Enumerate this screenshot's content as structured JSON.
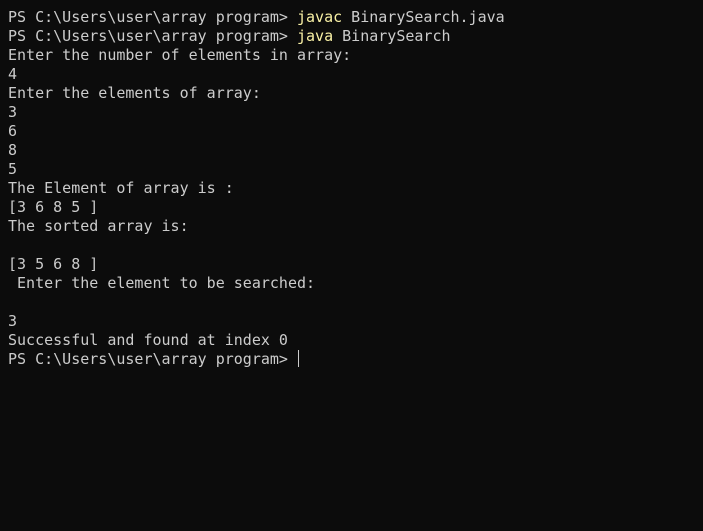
{
  "terminal": {
    "colors": {
      "background": "#0c0c0c",
      "text": "#cccccc",
      "command": "#f9f1a5"
    },
    "session": {
      "prompt": "PS C:\\Users\\user\\array program> ",
      "cmd1": "javac",
      "args1": " BinarySearch.java",
      "cmd2": "java",
      "args2": " BinarySearch"
    },
    "output": [
      "Enter the number of elements in array:",
      "4",
      "Enter the elements of array:",
      "3",
      "6",
      "8",
      "5",
      "The Element of array is :",
      "[3 6 8 5 ]",
      "The sorted array is:",
      "",
      "[3 5 6 8 ]",
      " Enter the element to be searched:",
      "",
      "3",
      "Successful and found at index 0"
    ]
  }
}
